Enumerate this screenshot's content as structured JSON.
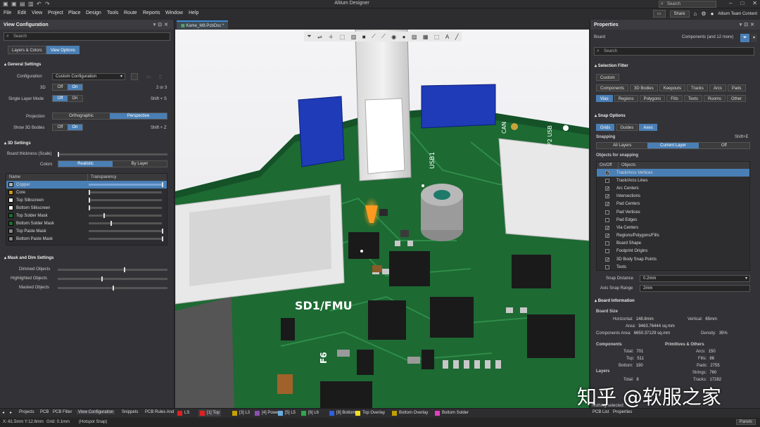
{
  "app": {
    "title": "Altium Designer",
    "search_placeholder": "Search"
  },
  "menu": [
    "File",
    "Edit",
    "View",
    "Project",
    "Place",
    "Design",
    "Tools",
    "Route",
    "Reports",
    "Window",
    "Help"
  ],
  "menu_right": {
    "share": "Share",
    "account": "Altium Team Content"
  },
  "left_panel": {
    "title": "View Configuration",
    "search_placeholder": "Search",
    "tabs": [
      "Layers & Colors",
      "View Options"
    ],
    "general_settings": "General Settings",
    "configuration_label": "Configuration",
    "configuration_value": "Custom Configuration",
    "three_d_label": "3D",
    "off": "Off",
    "on": "On",
    "three_d_hint": "2 or 3",
    "single_layer_label": "Single Layer Mode",
    "single_layer_hint": "Shift + S",
    "projection_label": "Projection",
    "projection_options": [
      "Orthographic",
      "Perspective"
    ],
    "show3d_label": "Show 3D Bodies",
    "show3d_hint": "Shift + Z",
    "settings_3d": "3D Settings",
    "board_thickness": "Board thickness (Scale)",
    "colors_label": "Colors",
    "colors_options": [
      "Realistic",
      "By Layer"
    ],
    "layer_table_headers": [
      "Name",
      "Transparency"
    ],
    "layers": [
      {
        "name": "Copper",
        "color": "#b0b0b0",
        "t": 1.0,
        "sel": true
      },
      {
        "name": "Core",
        "color": "#c8961e",
        "t": 0.0
      },
      {
        "name": "Top Silkscreen",
        "color": "#ffffff",
        "t": 0.0
      },
      {
        "name": "Bottom Silkscreen",
        "color": "#ffffff",
        "t": 0.0
      },
      {
        "name": "Top Solder Mask",
        "color": "#1e6e2e",
        "t": 0.2
      },
      {
        "name": "Bottom Solder Mask",
        "color": "#1e6e2e",
        "t": 0.3
      },
      {
        "name": "Top Paste Mask",
        "color": "#888888",
        "t": 1.0
      },
      {
        "name": "Bottom Paste Mask",
        "color": "#888888",
        "t": 1.0
      }
    ],
    "mask_dim": "Mask and Dim Settings",
    "dim_items": [
      {
        "label": "Dimmed Objects",
        "level": 0.6
      },
      {
        "label": "Highlighted Objects",
        "level": 0.4
      },
      {
        "label": "Masked Objects",
        "level": 0.5
      }
    ]
  },
  "doc_tab": "Kame_M8.PcbDoc *",
  "pcb_labels": {
    "usb1": "USB1",
    "sd": "SD1/FMU",
    "f6": "F6",
    "can": "CAN",
    "usb2": "P2 USB"
  },
  "right_panel": {
    "title": "Properties",
    "board": "Board",
    "components_filter": "Components (and 12 more)",
    "search_placeholder": "Search",
    "selection_filter": "Selection Filter",
    "filter_chips": [
      [
        {
          "t": "Custom",
          "on": false
        }
      ],
      [
        {
          "t": "Components",
          "on": false
        },
        {
          "t": "3D Bodies",
          "on": false
        },
        {
          "t": "Keepouts",
          "on": false
        },
        {
          "t": "Tracks",
          "on": false
        },
        {
          "t": "Arcs",
          "on": false
        },
        {
          "t": "Pads",
          "on": false
        }
      ],
      [
        {
          "t": "Vias",
          "on": true
        },
        {
          "t": "Regions",
          "on": false
        },
        {
          "t": "Polygons",
          "on": false
        },
        {
          "t": "Fills",
          "on": false
        },
        {
          "t": "Texts",
          "on": false
        },
        {
          "t": "Rooms",
          "on": false
        },
        {
          "t": "Other",
          "on": false
        }
      ]
    ],
    "snap_options": "Snap Options",
    "snap_chips": [
      {
        "t": "Grids",
        "on": true
      },
      {
        "t": "Guides",
        "on": false
      },
      {
        "t": "Axes",
        "on": true
      }
    ],
    "snapping": "Snapping",
    "snapping_hint": "Shift+E",
    "snapping_options": [
      "All Layers",
      "Current Layer",
      "Off"
    ],
    "objects_for_snapping": "Objects for snapping",
    "obj_headers": [
      "On/Off",
      "Objects"
    ],
    "objects": [
      {
        "name": "Track/Arcs Vertices",
        "on": true,
        "sel": true
      },
      {
        "name": "Track/Arcs Lines",
        "on": false
      },
      {
        "name": "Arc Centers",
        "on": true
      },
      {
        "name": "Intersections",
        "on": true
      },
      {
        "name": "Pad Centers",
        "on": true
      },
      {
        "name": "Pad Vertices",
        "on": false
      },
      {
        "name": "Pad Edges",
        "on": false
      },
      {
        "name": "Via Centers",
        "on": true
      },
      {
        "name": "Regions/Polygons/Fills",
        "on": true
      },
      {
        "name": "Board Shape",
        "on": false
      },
      {
        "name": "Footprint Origins",
        "on": false
      },
      {
        "name": "3D Body Snap Points",
        "on": true
      },
      {
        "name": "Texts",
        "on": false
      }
    ],
    "snap_distance_label": "Snap Distance",
    "snap_distance": "0.2mm",
    "axis_snap_label": "Axis Snap Range",
    "axis_snap": "2mm",
    "board_info": "Board Information",
    "board_size": "Board Size",
    "horizontal_label": "Horizontal:",
    "horizontal": "148.8mm",
    "vertical_label": "Vertical:",
    "vertical": "65mm",
    "area_label": "Area:",
    "area": "9463.76444 sq.mm",
    "comp_area_label": "Components Area:",
    "comp_area": "6650.37129 sq.mm",
    "density_label": "Density:",
    "density": "35%",
    "components": "Components",
    "total_label": "Total:",
    "total": "701",
    "top_label": "Top:",
    "top": "511",
    "bottom_label": "Bottom:",
    "bottom": "190",
    "primitives": "Primitives & Others",
    "arcs_label": "Arcs:",
    "arcs": "150",
    "fills_label": "Fills:",
    "fills": "86",
    "pads_label": "Pads:",
    "pads": "2755",
    "strings_label": "Strings:",
    "strings": "760",
    "tracks_label": "Tracks:",
    "tracks": "17282",
    "layers": "Layers",
    "layers_total_label": "Total:",
    "layers_total": "8",
    "nothing_selected": "Nothing selected"
  },
  "bottom_tabs": [
    "Projects",
    "PCB",
    "PCB Filter",
    "View Configuration",
    "Snippets",
    "PCB Rules And"
  ],
  "layer_tabs": [
    {
      "t": "LS",
      "c": "#e02020"
    },
    {
      "t": "[1] Top",
      "c": "#e02020"
    },
    {
      "t": "[3] L3",
      "c": "#c8a000"
    },
    {
      "t": "[4] Power",
      "c": "#8a4fb0"
    },
    {
      "t": "[5] L5",
      "c": "#6aaee0"
    },
    {
      "t": "[6] L6",
      "c": "#2ea84a"
    },
    {
      "t": "[8] Bottom",
      "c": "#3060e0"
    },
    {
      "t": "Top Overlay",
      "c": "#f0e020"
    },
    {
      "t": "Bottom Overlay",
      "c": "#c0a000"
    },
    {
      "t": "Bottom Solder",
      "c": "#e040c0"
    }
  ],
  "right_bottom_tabs": [
    "PCB List",
    "Properties"
  ],
  "status": {
    "coords": "X:-61.5mm Y:12.6mm",
    "grid": "Grid: 0.1mm",
    "snap": "(Hotspot Snap)",
    "panels": "Panels"
  },
  "watermark": "知乎 @软服之家"
}
